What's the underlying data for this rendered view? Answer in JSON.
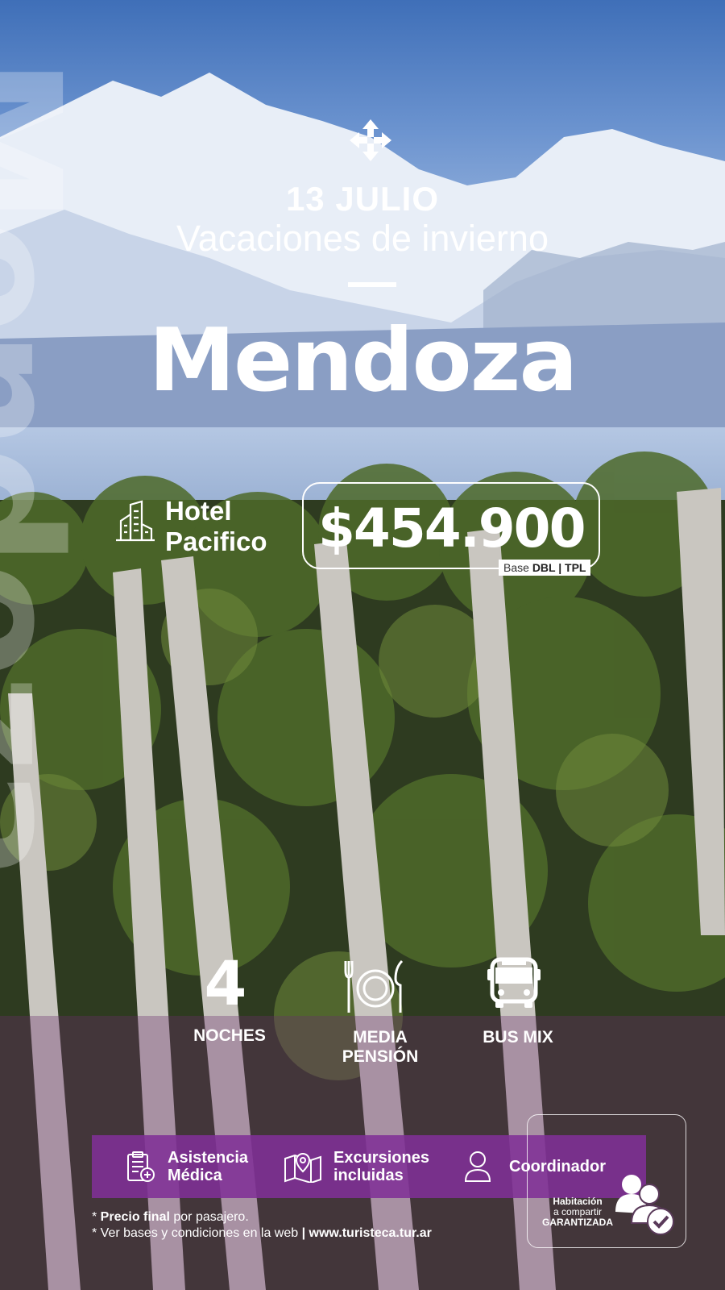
{
  "ghost_word": "Mendoza",
  "date": "13  JULIO",
  "subtitle": "Vacaciones de invierno",
  "destination": "Mendoza",
  "hotel": {
    "line1": "Hotel",
    "line2": "Pacifico",
    "icon": "building-icon"
  },
  "price": {
    "amount": "$454.900",
    "base_prefix": "Base ",
    "base_bold": "DBL | TPL"
  },
  "features": {
    "nights_number": "4",
    "nights_label": "NOCHES",
    "meal_line1": "MEDIA",
    "meal_line2": "PENSIÓN",
    "transport": "BUS MIX"
  },
  "services": [
    {
      "line1": "Asistencia",
      "line2": "Médica",
      "icon": "medical-clipboard-icon"
    },
    {
      "line1": "Excursiones",
      "line2": "incluidas",
      "icon": "map-pin-icon"
    },
    {
      "line1": "Coordinador",
      "line2": "",
      "icon": "person-icon"
    }
  ],
  "guarantee": {
    "line1": "Habitación",
    "line2": "a compartir",
    "line3": "GARANTIZADA"
  },
  "footer": {
    "bold1": "Precio final",
    "rest1": " por pasajero.",
    "line2": "* Ver bases y condiciones en la web",
    "sep": " | ",
    "web": "www.turisteca.tur.ar"
  },
  "colors": {
    "accent": "#803096",
    "sky": "#3f6fb8"
  }
}
